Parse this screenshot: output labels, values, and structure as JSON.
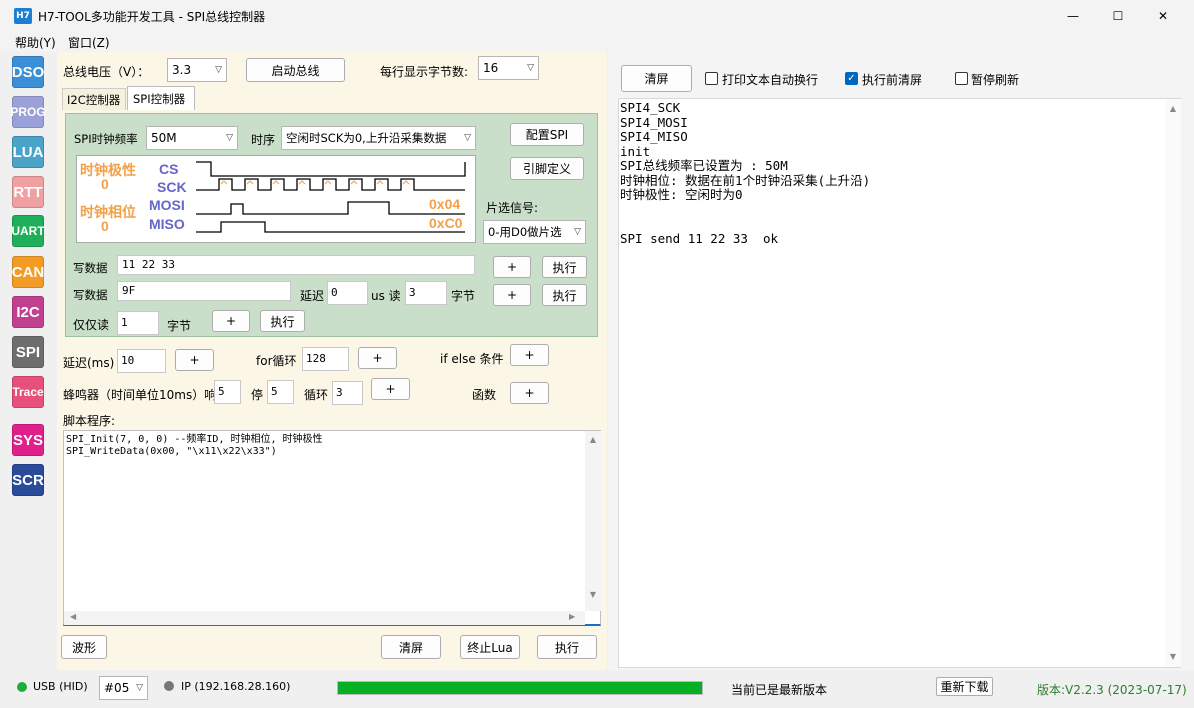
{
  "window": {
    "logo": "H7",
    "title": "H7-TOOL多功能开发工具 - SPI总线控制器",
    "minimize": "—",
    "maximize": "☐",
    "close": "✕"
  },
  "menu": [
    "帮助(Y)",
    "窗口(Z)"
  ],
  "toolbar": [
    {
      "label": "DSO",
      "color": "#3a8fd6"
    },
    {
      "label": "PROG",
      "color": "#9aa0d8"
    },
    {
      "label": "LUA",
      "color": "#4aa3c8"
    },
    {
      "label": "RTT",
      "color": "#f0a0a0"
    },
    {
      "label": "UART",
      "color": "#1fae5a"
    },
    {
      "label": "CAN",
      "color": "#f39c25"
    },
    {
      "label": "I2C",
      "color": "#c0418f"
    },
    {
      "label": "SPI",
      "color": "#6e6e6e"
    },
    {
      "label": "Trace",
      "color": "#e6507a"
    },
    {
      "label": "SYS",
      "color": "#e0208a"
    },
    {
      "label": "SCR",
      "color": "#2a4a9a"
    }
  ],
  "bus": {
    "voltage_label": "总线电压（V）：",
    "voltage_value": "3.3",
    "start_button": "启动总线",
    "bytes_per_line_label": "每行显示字节数:",
    "bytes_per_line_value": "16"
  },
  "tabs": [
    "I2C控制器",
    "SPI控制器"
  ],
  "spi": {
    "clock_label": "SPI时钟频率",
    "clock_value": "50M",
    "timing_label": "时序",
    "timing_value": "空闲时SCK为0,上升沿采集数据",
    "config_button": "配置SPI",
    "pin_button": "引脚定义",
    "cs_label": "片选信号:",
    "cs_value": "0-用D0做片选",
    "diagram": {
      "cpol_label": "时钟极性",
      "cpol_value": "0",
      "cpha_label": "时钟相位",
      "cpha_value": "0",
      "signals": [
        "CS",
        "SCK",
        "MOSI",
        "MISO"
      ],
      "mosi_value": "0x04",
      "miso_value": "0xC0"
    },
    "write1_label": "写数据",
    "write1_value": "11 22 33",
    "write2_label": "写数据",
    "write2_value": "9F",
    "delay_label": "延迟",
    "delay_value": "0",
    "us_read_label": "us 读",
    "read_value": "3",
    "bytes_label": "字节",
    "readonly_label": "仅仅读",
    "readonly_value": "1",
    "readonly_bytes_label": "字节",
    "plus": "+",
    "exec": "执行"
  },
  "script": {
    "delay_label": "延迟(ms)",
    "delay_value": "10",
    "for_label": "for循环",
    "for_value": "128",
    "ifelse_label": "if else 条件",
    "buzzer_label": "蜂鸣器（时间单位10ms）响",
    "buzzer_on": "5",
    "stop_label": "停",
    "stop_value": "5",
    "loop_label": "循环",
    "loop_value": "3",
    "func_label": "函数",
    "program_label": "脚本程序:",
    "code": [
      "SPI_Init(7, 0, 0) --频率ID, 时钟相位, 时钟极性",
      "SPI_WriteData(0x00, \"\\x11\\x22\\x33\")"
    ],
    "wave_button": "波形",
    "clear_button": "清屏",
    "stop_lua_button": "终止Lua",
    "exec_button": "执行"
  },
  "console": {
    "clear_button": "清屏",
    "wrap_label": "打印文本自动换行",
    "wrap_checked": false,
    "clear_before_label": "执行前清屏",
    "clear_before_checked": true,
    "pause_label": "暂停刷新",
    "pause_checked": false,
    "lines": [
      "SPI4_SCK",
      "SPI4_MOSI",
      "SPI4_MISO",
      "init",
      "SPI总线频率已设置为 : 50M",
      "时钟相位: 数据在前1个时钟沿采集(上升沿)",
      "时钟极性: 空闲时为0",
      "",
      "",
      "SPI send 11 22 33  ok"
    ]
  },
  "status": {
    "usb": "USB (HID)",
    "device": "#05",
    "ip": "IP (192.168.28.160)",
    "progress": 1.0,
    "message": "当前已是最新版本",
    "redownload_button": "重新下载",
    "version": "版本:V2.2.3 (2023-07-17)"
  }
}
